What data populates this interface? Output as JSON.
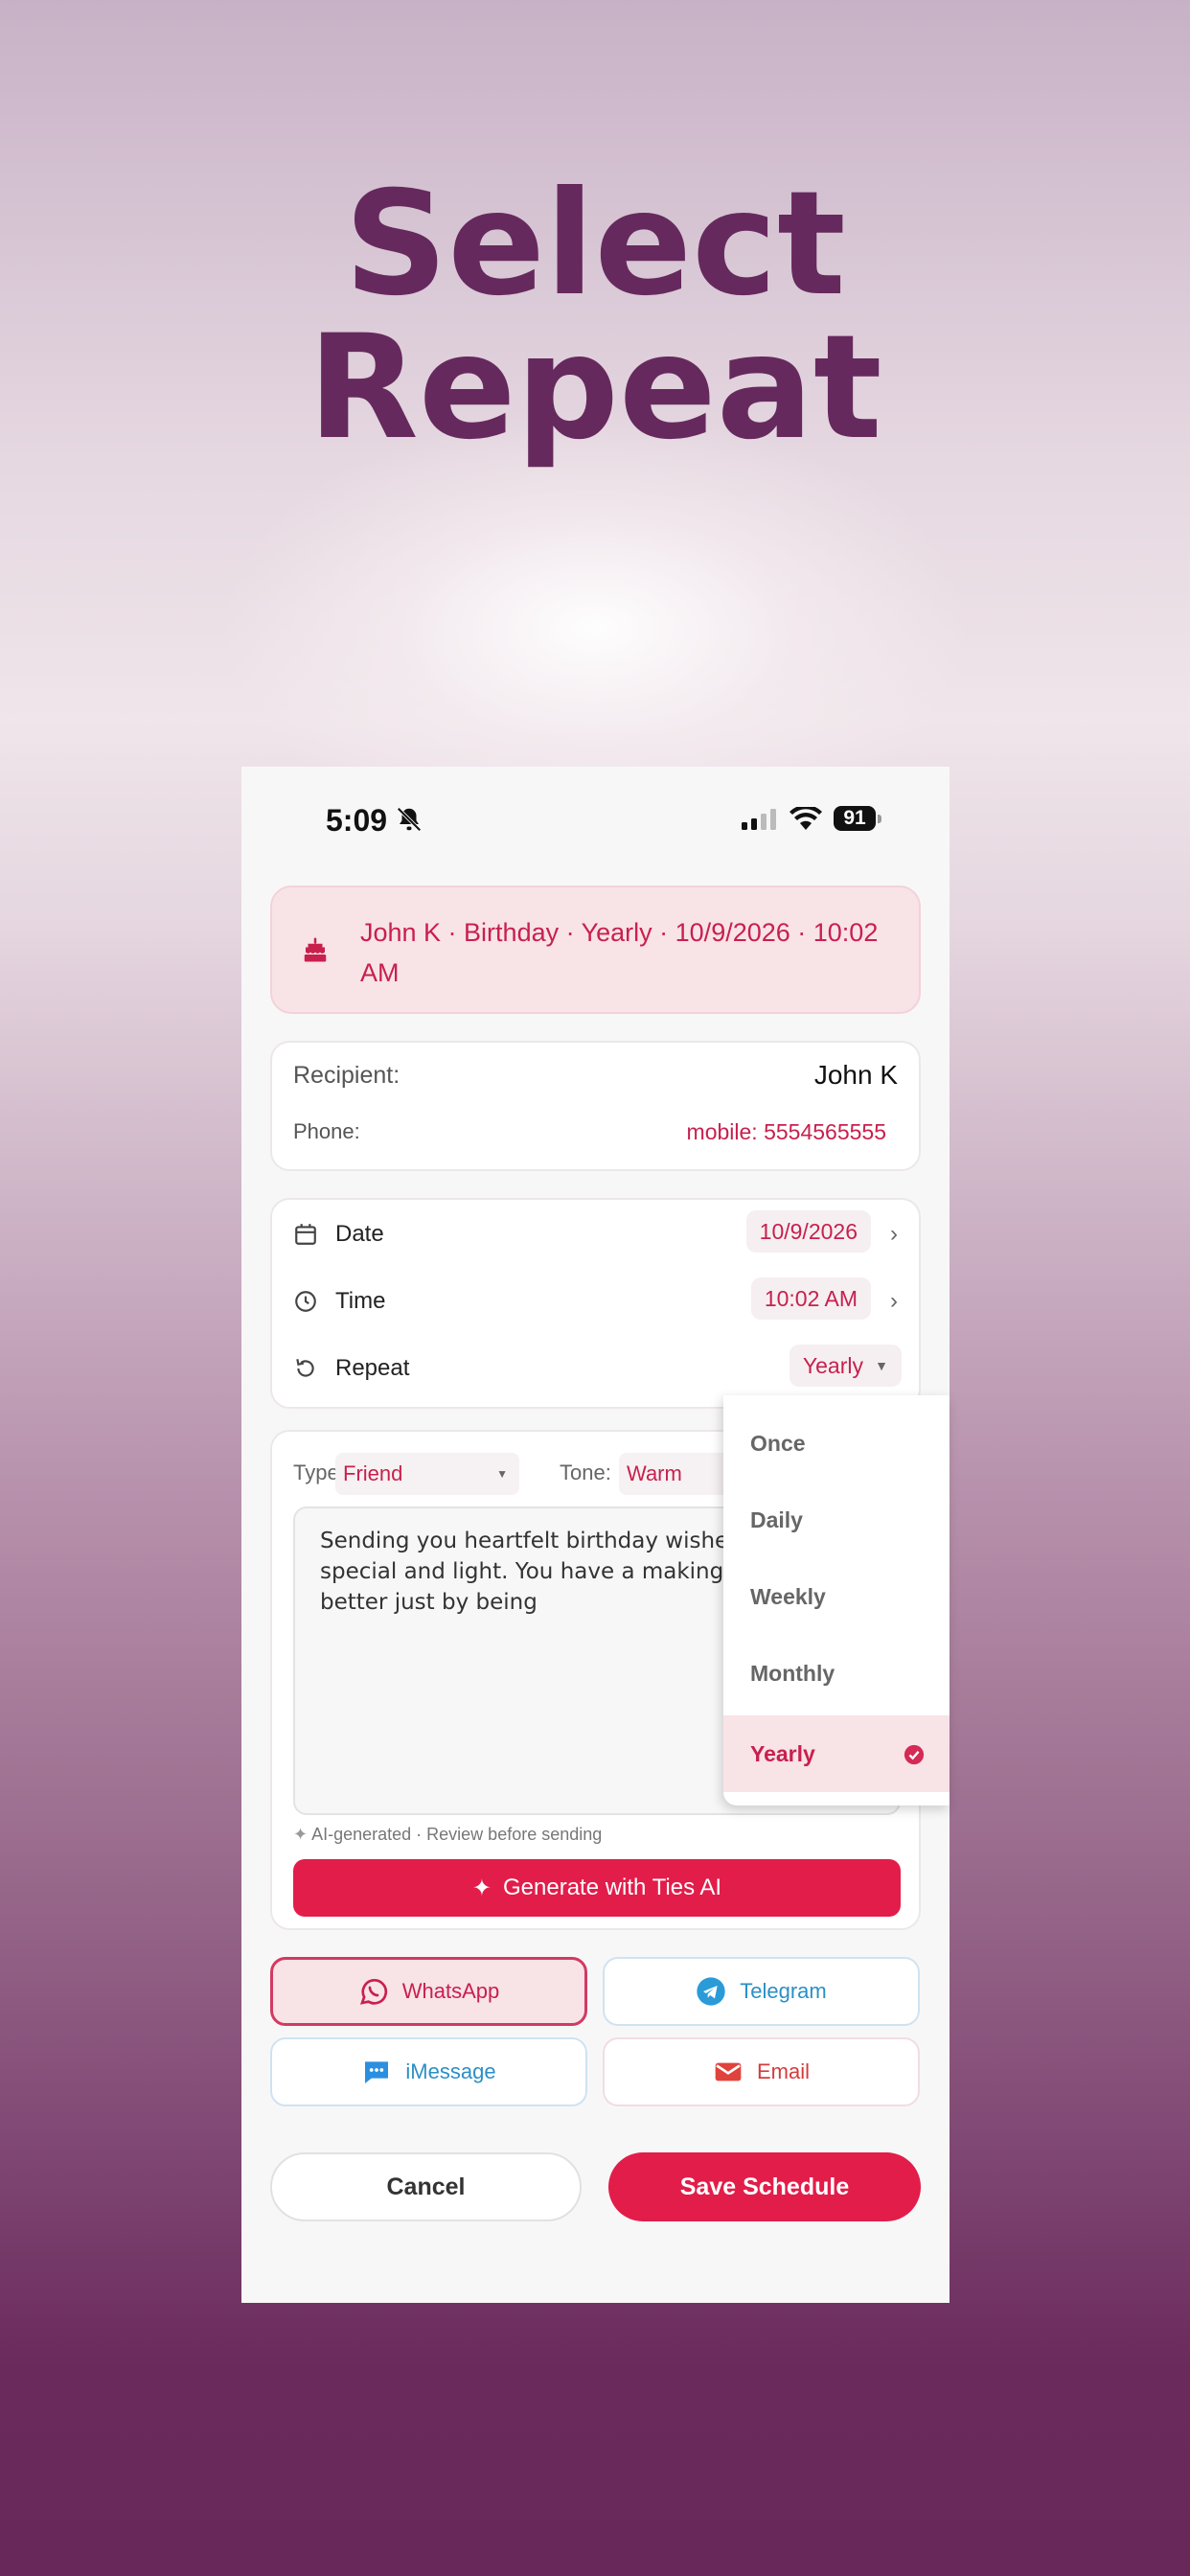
{
  "headline": {
    "line1": "Select",
    "line2": "Repeat"
  },
  "status_bar": {
    "time": "5:09",
    "battery": "91"
  },
  "banner": {
    "text": "John K · Birthday · Yearly · 10/9/2026 · 10:02 AM"
  },
  "recipient": {
    "label": "Recipient:",
    "name": "John K",
    "phone_label": "Phone:",
    "phone": "mobile: 5554565555"
  },
  "schedule": {
    "date_label": "Date",
    "date_value": "10/9/2026",
    "time_label": "Time",
    "time_value": "10:02 AM",
    "repeat_label": "Repeat",
    "repeat_value": "Yearly"
  },
  "message": {
    "type_label": "Type:",
    "type_value": "Friend",
    "tone_label": "Tone:",
    "tone_value": "Warm",
    "body": "Sending you heartfelt birthday wishes that feels special and light. You have a making everything better just by being",
    "ai_note": "AI-generated · Review before sending",
    "generate_label": "Generate with Ties AI"
  },
  "channels": {
    "whatsapp": "WhatsApp",
    "telegram": "Telegram",
    "imessage": "iMessage",
    "email": "Email"
  },
  "actions": {
    "cancel": "Cancel",
    "save": "Save Schedule"
  },
  "repeat_options": {
    "once": "Once",
    "daily": "Daily",
    "weekly": "Weekly",
    "monthly": "Monthly",
    "yearly": "Yearly",
    "selected": "Yearly"
  },
  "colors": {
    "accent": "#e21d4a",
    "accent_text": "#c8204d",
    "headline": "#66295d"
  }
}
